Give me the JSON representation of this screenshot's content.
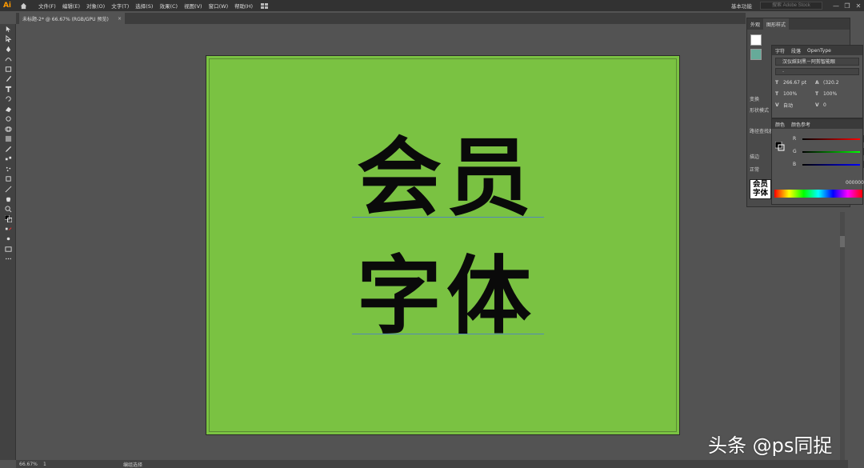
{
  "app": {
    "logo": "Ai",
    "menu": [
      "文件(F)",
      "编辑(E)",
      "对象(O)",
      "文字(T)",
      "选择(S)",
      "效果(C)",
      "视图(V)",
      "窗口(W)",
      "帮助(H)"
    ],
    "workspace": "基本功能",
    "stock_placeholder": "搜索 Adobe Stock",
    "window_buttons": [
      "—",
      "❐",
      "✕"
    ]
  },
  "document": {
    "tab_title": "未标题-2* @ 66.67% (RGB/GPU 预览)",
    "tab_close": "×"
  },
  "artboard": {
    "line1": "会员",
    "line2": "字体",
    "background": "#7ac242",
    "text_color": "#0a0a0a"
  },
  "status": {
    "zoom": "66.67%",
    "page": "1",
    "mode": "编组选择"
  },
  "panels": {
    "appearance_tab": "外观",
    "graphic_styles_tab": "图形样式",
    "transform_label": "变换",
    "shape_mode_label": "形状模式",
    "pathfinder_label": "路径查找器",
    "stroke_label": "描边",
    "blend_label": "正常",
    "character": {
      "tabs": [
        "字符",
        "段落",
        "OpenType"
      ],
      "font_family": "汉仪綵刻黑－阿剪智能眼",
      "font_style": "-",
      "size": "266.67 pt",
      "leading": "(320.2",
      "scale_v": "100%",
      "scale_h": "100%",
      "kerning": "自动",
      "tracking": "0"
    },
    "color": {
      "tabs": [
        "颜色",
        "颜色参考"
      ],
      "r": "0",
      "g": "0",
      "b": "0",
      "hex": "000000",
      "r_label": "R",
      "g_label": "G",
      "b_label": "B"
    },
    "type_preview": "会员字体"
  },
  "watermark": "头条 @ps同捉"
}
